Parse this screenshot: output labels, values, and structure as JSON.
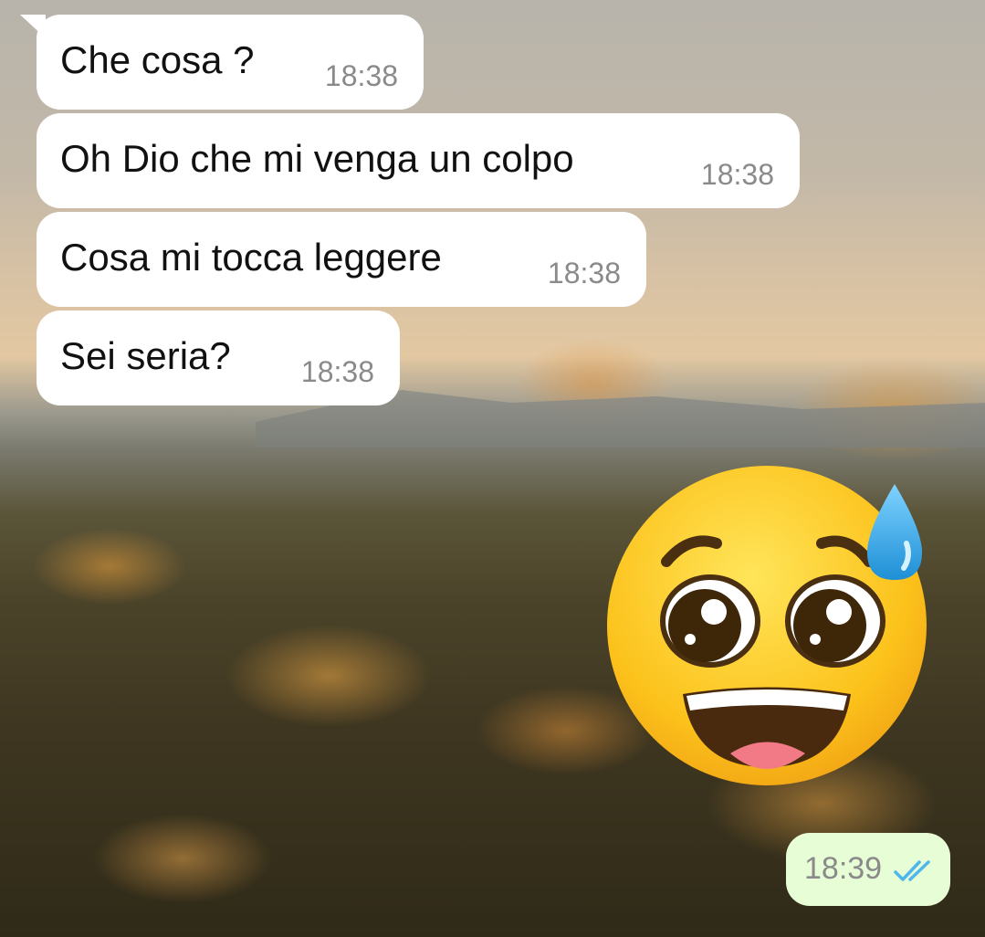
{
  "chat": {
    "incoming": [
      {
        "text": "Che cosa ?",
        "time": "18:38"
      },
      {
        "text": "Oh Dio che mi venga un colpo",
        "time": "18:38"
      },
      {
        "text": "Cosa mi tocca leggere",
        "time": "18:38"
      },
      {
        "text": "Sei seria?",
        "time": "18:38"
      }
    ],
    "outgoing_sticker": {
      "emoji_name": "face-holding-back-tears-sweat-icon",
      "time": "18:39",
      "status": "read-double-check-icon"
    }
  },
  "colors": {
    "incoming_bubble": "#ffffff",
    "outgoing_bubble": "#e7fdd6",
    "read_ticks": "#4fb6ec",
    "timestamp": "#8a8a8a"
  }
}
